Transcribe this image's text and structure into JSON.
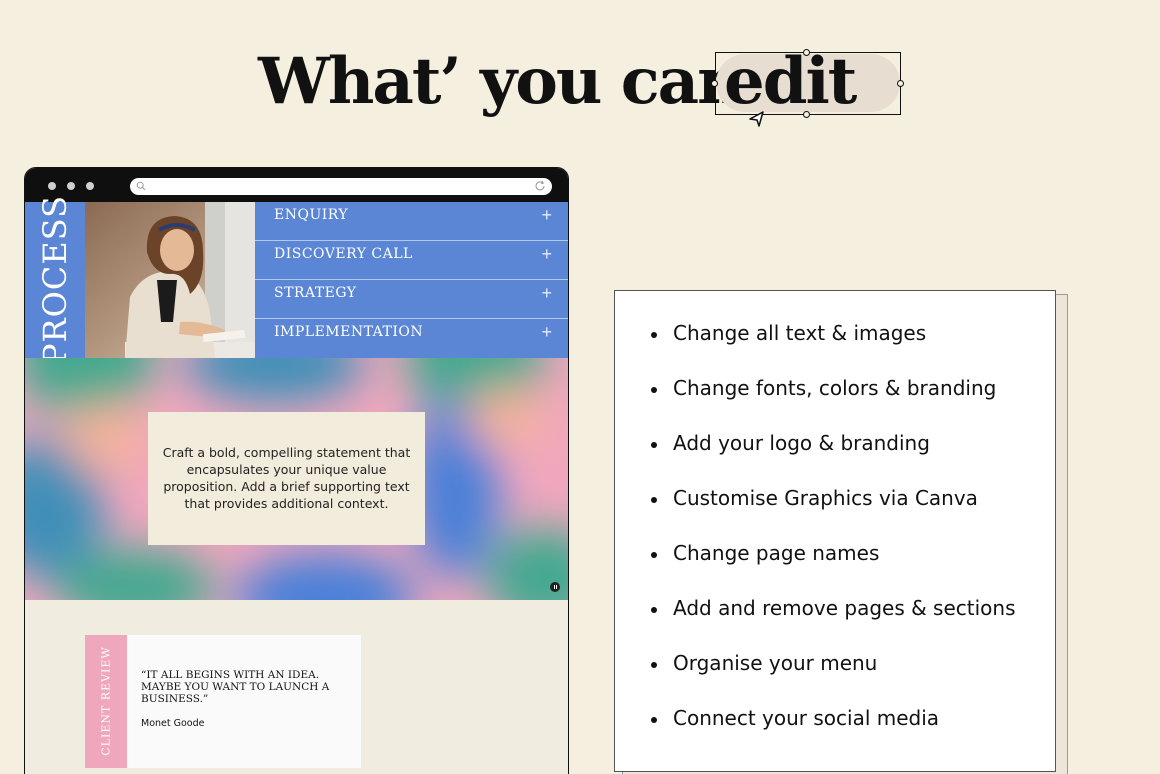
{
  "heading": {
    "part1": "What’ you can",
    "edit_word": "edit"
  },
  "browser": {
    "url": "",
    "process_label": "PROCESS",
    "accordion": [
      {
        "label": "ENQUIRY",
        "icon": "plus-icon"
      },
      {
        "label": "DISCOVERY CALL",
        "icon": "plus-icon"
      },
      {
        "label": "STRATEGY",
        "icon": "plus-icon"
      },
      {
        "label": "IMPLEMENTATION",
        "icon": "plus-icon"
      }
    ],
    "statement": "Craft a bold, compelling statement that encapsulates your unique value proposition. Add a brief supporting text that provides additional context.",
    "review": {
      "side_label": "CLIENT REVIEW",
      "quote": "“IT ALL BEGINS WITH AN IDEA. MAYBE YOU WANT TO LAUNCH A BUSINESS.”",
      "author": "Monet Goode"
    }
  },
  "features": [
    "Change all text & images",
    "Change fonts, colors & branding",
    "Add your logo & branding",
    "Customise Graphics  via Canva",
    "Change page names",
    "Add and remove pages & sections",
    "Organise your menu",
    "Connect your social media"
  ],
  "colors": {
    "background": "#f5efdf",
    "accent_blue": "#5b86d6",
    "accent_pink": "#efa7be",
    "gradient_green": "#43a98f"
  }
}
